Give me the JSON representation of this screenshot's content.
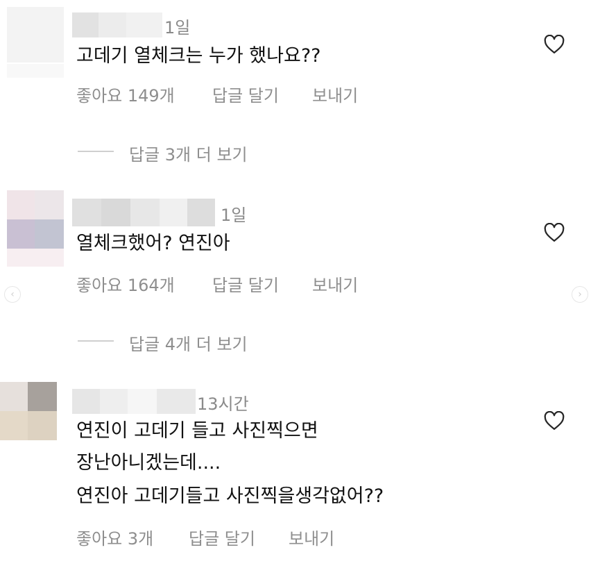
{
  "comments": [
    {
      "time": "1일",
      "text_lines": [
        "고데기 열체크는 누가 했나요??"
      ],
      "likes": "좋아요 149개",
      "reply_label": "답글 달기",
      "send_label": "보내기",
      "view_replies": "답글 3개 더 보기"
    },
    {
      "time": "1일",
      "text_lines": [
        "열체크했어? 연진아"
      ],
      "likes": "좋아요 164개",
      "reply_label": "답글 달기",
      "send_label": "보내기",
      "view_replies": "답글 4개 더 보기"
    },
    {
      "time": "13시간",
      "text_lines": [
        "연진이 고데기 들고 사진찍으면",
        "장난아니겠는데....",
        "연진아 고데기들고 사진찍을생각없어??"
      ],
      "likes": "좋아요 3개",
      "reply_label": "답글 달기",
      "send_label": "보내기"
    }
  ],
  "icons": {
    "like": "heart-outline-icon",
    "prev": "chevron-left-icon",
    "next": "chevron-right-icon"
  }
}
